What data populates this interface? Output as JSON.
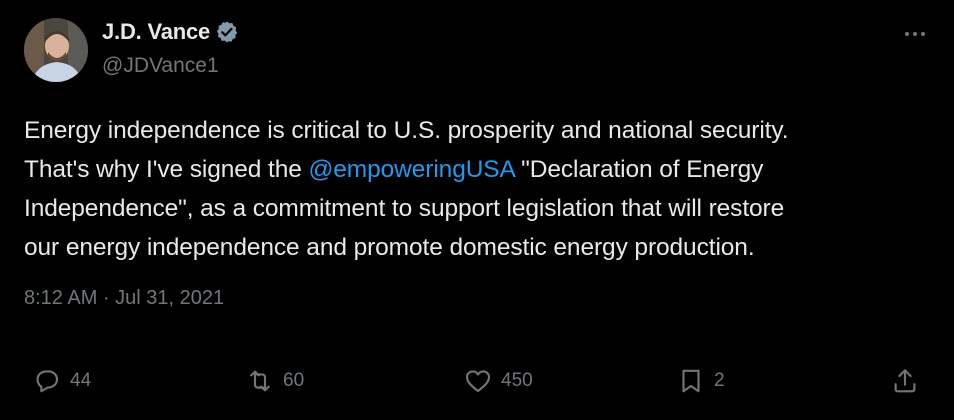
{
  "author": {
    "name": "J.D. Vance",
    "handle": "@JDVance1",
    "verified": true
  },
  "tweet": {
    "text_before_mention": "Energy independence is critical to U.S. prosperity and national security.\nThat's why I've signed the ",
    "mention": "@empoweringUSA",
    "text_after_mention": " \"Declaration of Energy\nIndependence\", as a commitment to support legislation that will restore\nour energy independence and promote domestic energy production.",
    "timestamp": "8:12 AM · Jul 31, 2021"
  },
  "actions": {
    "replies": "44",
    "reposts": "60",
    "likes": "450",
    "bookmarks": "2"
  },
  "colors": {
    "background": "#000000",
    "text": "#e7e9ea",
    "secondary": "#71767b",
    "link": "#1d9bf0"
  },
  "icons": {
    "verified": "verified-badge-icon",
    "more": "more-dots-icon",
    "reply": "reply-bubble-icon",
    "repost": "repost-icon",
    "like": "heart-icon",
    "bookmark": "bookmark-icon",
    "share": "share-upload-icon"
  }
}
